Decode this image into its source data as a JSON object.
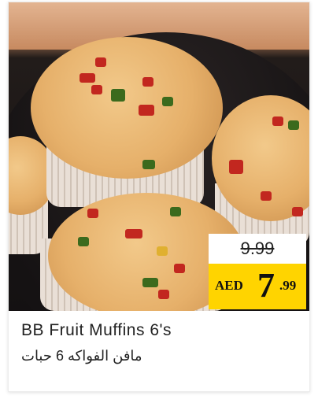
{
  "product": {
    "name_en": "BB Fruit Muffins 6's",
    "name_ar": "مافن الفواكه 6 حبات",
    "image_alt": "Fruit muffins on a dark tray"
  },
  "price": {
    "old": "9.99",
    "currency": "AED",
    "new_integer": "7",
    "new_decimal": ".99"
  },
  "colors": {
    "price_highlight": "#ffd400",
    "text": "#222222"
  }
}
